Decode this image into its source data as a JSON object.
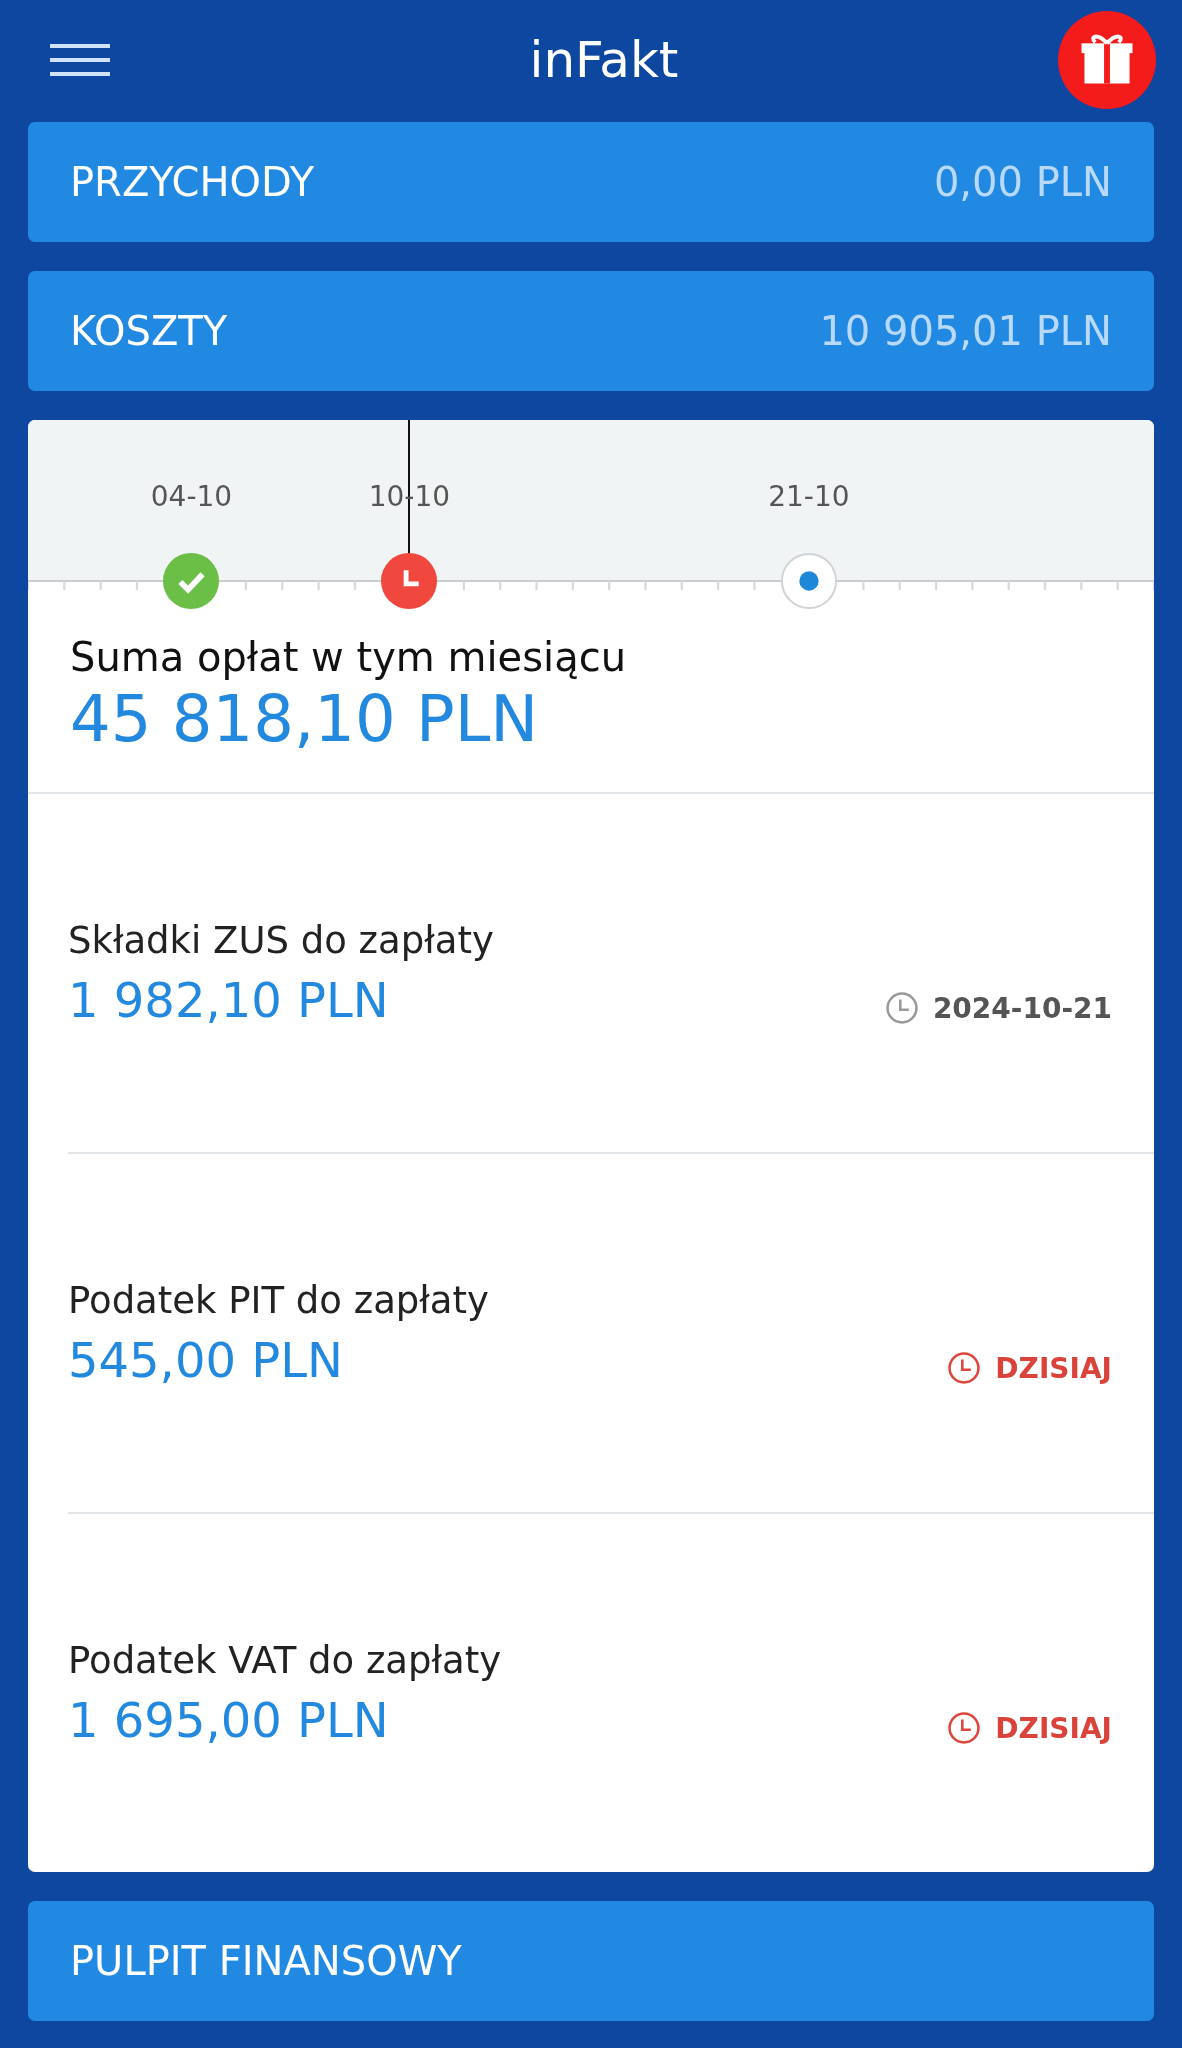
{
  "header": {
    "title": "inFakt"
  },
  "summary_cards": [
    {
      "label": "PRZYCHODY",
      "value": "0,00 PLN"
    },
    {
      "label": "KOSZTY",
      "value": "10 905,01 PLN"
    }
  ],
  "timeline": {
    "markers": [
      {
        "date": "04-10",
        "kind": "done",
        "today": false
      },
      {
        "date": "10-10",
        "kind": "overdue",
        "today": true
      },
      {
        "date": "21-10",
        "kind": "upcoming",
        "today": false
      }
    ]
  },
  "total": {
    "label": "Suma opłat w tym miesiącu",
    "amount": "45 818,10 PLN"
  },
  "payments": [
    {
      "label": "Składki ZUS do zapłaty",
      "amount": "1 982,10 PLN",
      "due": "2024-10-21",
      "kind": "date"
    },
    {
      "label": "Podatek PIT do zapłaty",
      "amount": "545,00 PLN",
      "due": "DZISIAJ",
      "kind": "today"
    },
    {
      "label": "Podatek VAT do zapłaty",
      "amount": "1 695,00 PLN",
      "due": "DZISIAJ",
      "kind": "today"
    }
  ],
  "footer_card": {
    "label": "PULPIT FINANSOWY"
  }
}
